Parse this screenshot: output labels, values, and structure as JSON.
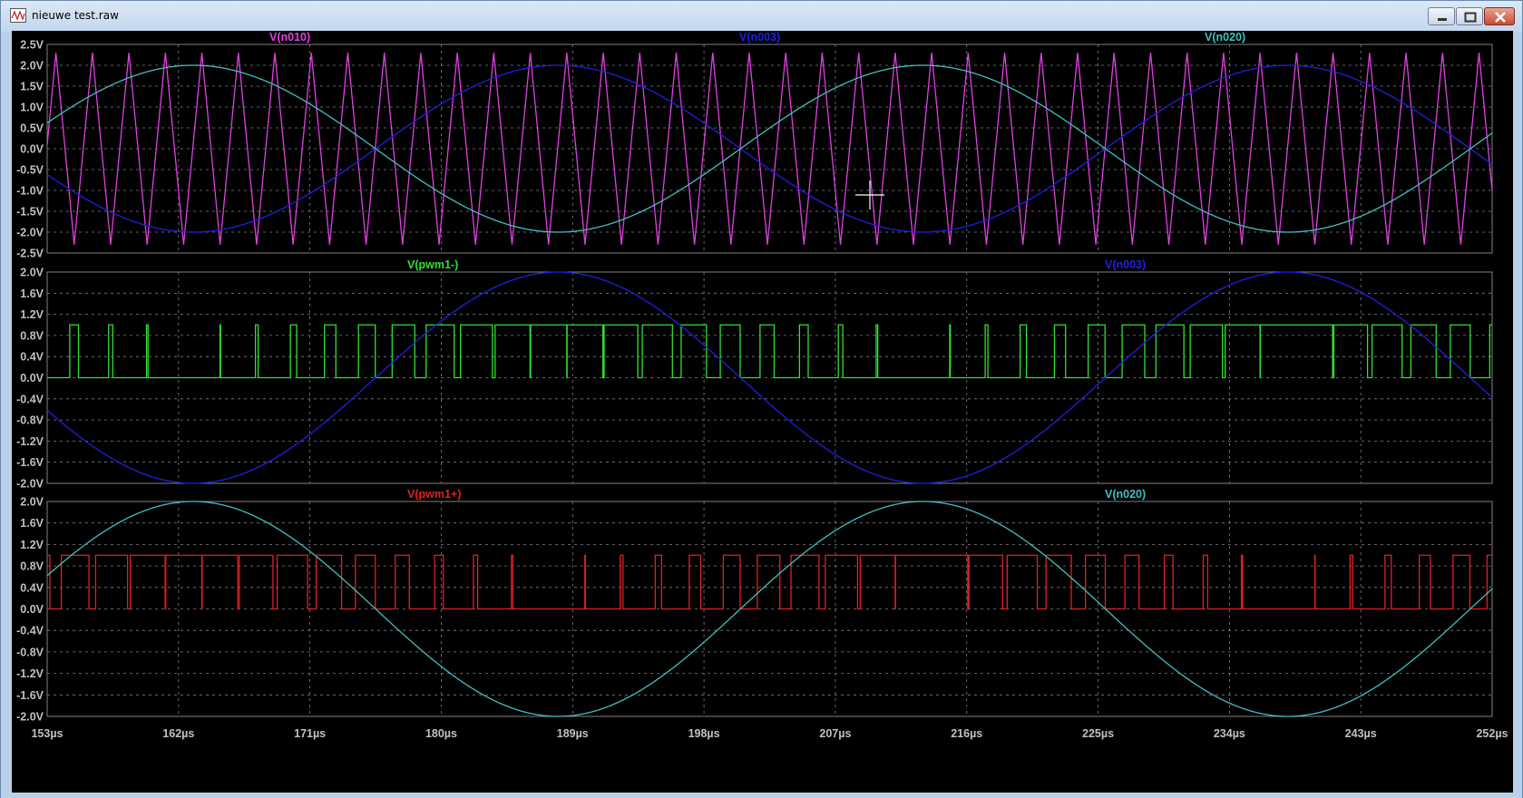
{
  "window": {
    "title": "nieuwe test.raw",
    "icons": {
      "app": "waveform-viewer-icon",
      "minimize": "minimize-icon",
      "maximize": "maximize-icon",
      "close": "close-icon"
    }
  },
  "colors": {
    "background": "#000000",
    "grid": "#7f7f7f",
    "axis_text": "#c0c0c0",
    "v_n010": "#e040e0",
    "v_n003": "#2020e0",
    "v_n020": "#40c0c0",
    "v_pwm1_minus": "#30e030",
    "v_pwm1_plus": "#e02020"
  },
  "x_axis": {
    "range": [
      153,
      252
    ],
    "ticks": [
      153,
      162,
      171,
      180,
      189,
      198,
      207,
      216,
      225,
      234,
      243,
      252
    ],
    "tick_labels": [
      "153µs",
      "162µs",
      "171µs",
      "180µs",
      "189µs",
      "198µs",
      "207µs",
      "216µs",
      "225µs",
      "234µs",
      "243µs",
      "252µs"
    ]
  },
  "chart_data": [
    {
      "type": "line",
      "pane": "top",
      "ylim": [
        -2.5,
        2.5
      ],
      "y_ticks": [
        2.5,
        2.0,
        1.5,
        1.0,
        0.5,
        0.0,
        -0.5,
        -1.0,
        -1.5,
        -2.0,
        -2.5
      ],
      "y_tick_labels": [
        "2.5V",
        "2.0V",
        "1.5V",
        "1.0V",
        "0.5V",
        "0.0V",
        "-0.5V",
        "-1.0V",
        "-1.5V",
        "-2.0V",
        "-2.5V"
      ],
      "series": [
        {
          "name": "V(n010)",
          "kind": "triangle",
          "amplitude": 2.3,
          "period_us": 2.5,
          "phase_us": 153.6,
          "color_key": "v_n010"
        },
        {
          "name": "V(n003)",
          "kind": "sine",
          "amplitude": 2.0,
          "period_us": 50,
          "peak_us": 188,
          "color_key": "v_n003"
        },
        {
          "name": "V(n020)",
          "kind": "sine",
          "amplitude": 2.0,
          "period_us": 50,
          "peak_us": 163,
          "color_key": "v_n020"
        }
      ]
    },
    {
      "type": "line",
      "pane": "middle",
      "ylim": [
        -2.0,
        2.0
      ],
      "y_ticks": [
        2.0,
        1.6,
        1.2,
        0.8,
        0.4,
        0.0,
        -0.4,
        -0.8,
        -1.2,
        -1.6,
        -2.0
      ],
      "y_tick_labels": [
        "2.0V",
        "1.6V",
        "1.2V",
        "0.8V",
        "0.4V",
        "0.0V",
        "-0.4V",
        "-0.8V",
        "-1.2V",
        "-1.6V",
        "-2.0V"
      ],
      "series": [
        {
          "name": "V(pwm1-)",
          "kind": "pwm",
          "high": 1.0,
          "low": 0.0,
          "period_us": 2.5,
          "compare_with": "V(n003)",
          "color_key": "v_pwm1_minus"
        },
        {
          "name": "V(n003)",
          "kind": "sine",
          "amplitude": 2.0,
          "period_us": 50,
          "peak_us": 188,
          "color_key": "v_n003"
        }
      ]
    },
    {
      "type": "line",
      "pane": "bottom",
      "ylim": [
        -2.0,
        2.0
      ],
      "y_ticks": [
        2.0,
        1.6,
        1.2,
        0.8,
        0.4,
        0.0,
        -0.4,
        -0.8,
        -1.2,
        -1.6,
        -2.0
      ],
      "y_tick_labels": [
        "2.0V",
        "1.6V",
        "1.2V",
        "0.8V",
        "0.4V",
        "0.0V",
        "-0.4V",
        "-0.8V",
        "-1.2V",
        "-1.6V",
        "-2.0V"
      ],
      "series": [
        {
          "name": "V(pwm1+)",
          "kind": "pwm",
          "high": 1.0,
          "low": 0.0,
          "period_us": 2.5,
          "compare_with": "V(n020)",
          "color_key": "v_pwm1_plus"
        },
        {
          "name": "V(n020)",
          "kind": "sine",
          "amplitude": 2.0,
          "period_us": 50,
          "peak_us": 163,
          "color_key": "v_n020"
        }
      ]
    }
  ]
}
